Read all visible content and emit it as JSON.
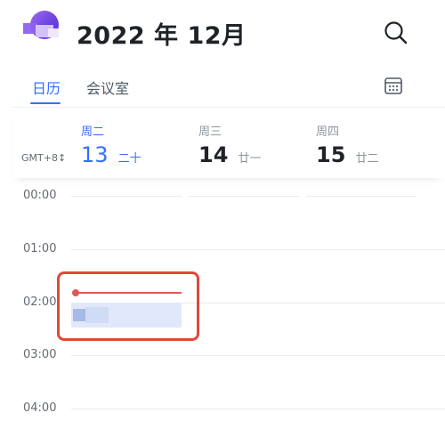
{
  "header": {
    "title": "2022 年 12月"
  },
  "tabs": [
    {
      "label": "日历",
      "active": true
    },
    {
      "label": "会议室",
      "active": false
    }
  ],
  "timezone": "GMT+8↕",
  "days": [
    {
      "weekday": "周二",
      "date": "13",
      "lunar": "二十",
      "today": true
    },
    {
      "weekday": "周三",
      "date": "14",
      "lunar": "廿一",
      "today": false
    },
    {
      "weekday": "周四",
      "date": "15",
      "lunar": "廿二",
      "today": false
    }
  ],
  "hours": [
    "00:00",
    "01:00",
    "02:00",
    "03:00",
    "04:00"
  ],
  "icons": {
    "app_logo": "app-logo-icon",
    "search": "search-icon",
    "calendar_view": "calendar-grid-icon"
  },
  "colors": {
    "accent": "#3370ff",
    "now_indicator": "#e05656",
    "event_fill": "#e1e8fb",
    "annotation_box": "#e0493a"
  }
}
